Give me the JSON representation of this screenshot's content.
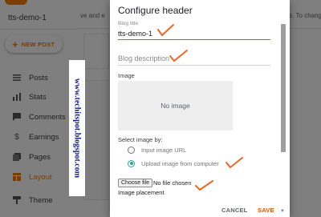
{
  "app": {
    "blog_name": "tts-demo-1",
    "new_post_label": "NEW POST",
    "header_text_left": "ve and e",
    "header_text_right": "ts. To chang",
    "nav": [
      {
        "label": "Posts",
        "icon": "posts-icon"
      },
      {
        "label": "Stats",
        "icon": "stats-icon"
      },
      {
        "label": "Comments",
        "icon": "comments-icon"
      },
      {
        "label": "Earnings",
        "icon": "dollar-icon"
      },
      {
        "label": "Pages",
        "icon": "pages-icon"
      },
      {
        "label": "Layout",
        "icon": "layout-icon",
        "active": true
      },
      {
        "label": "Theme",
        "icon": "theme-icon"
      }
    ],
    "accent_color": "#f57c00"
  },
  "dialog": {
    "title": "Configure header",
    "blog_title_label": "Blog title",
    "blog_title_value": "tts-demo-1",
    "blog_description_placeholder": "Blog description",
    "image_label": "Image",
    "no_image_text": "No image",
    "select_image_label": "Select image by:",
    "radio_options": [
      {
        "label": "Input image URL",
        "checked": false
      },
      {
        "label": "Upload image from computer",
        "checked": true
      }
    ],
    "choose_file_label": "Choose file",
    "no_file_text": "No file chosen",
    "image_placement_label": "Image placement",
    "cancel_label": "CANCEL",
    "save_label": "SAVE",
    "save_color": "#e65100",
    "radio_color": "#26a69a"
  },
  "watermark": {
    "text": "www.techitspot.blogspot.com",
    "color": "#0d1a8a"
  },
  "annotation_color": "#f26522"
}
